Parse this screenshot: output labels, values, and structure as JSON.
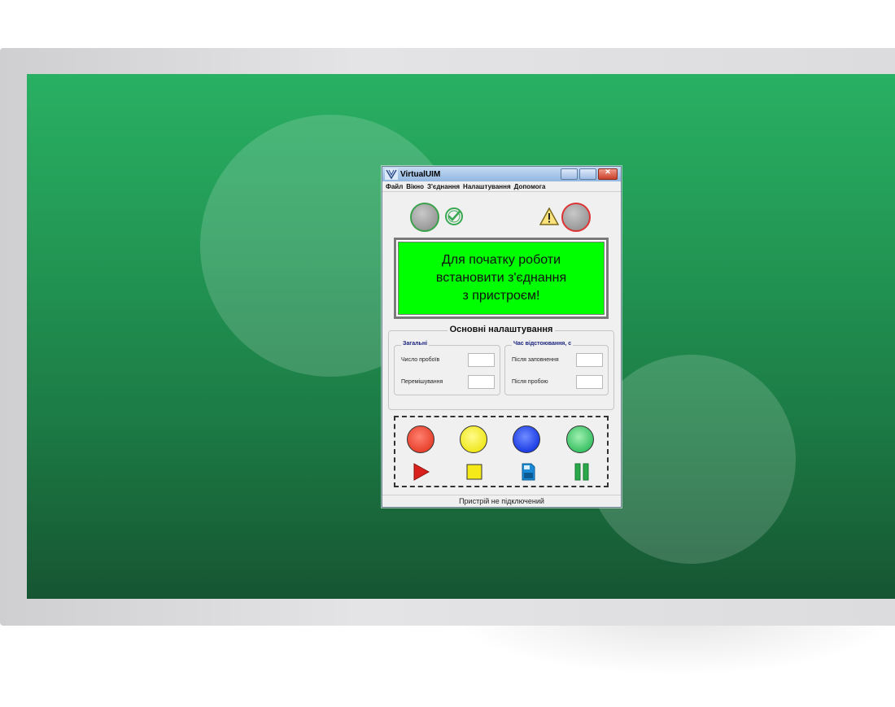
{
  "window": {
    "title": "VirtualUIM",
    "buttons": {
      "minimize": "",
      "maximize": "",
      "close": "✕"
    }
  },
  "menu": [
    "Файл",
    "Вікно",
    "З'єднання",
    "Налаштування",
    "Допомога"
  ],
  "indicators": {
    "left_icon": "check-circle-icon",
    "right_icon": "warning-icon"
  },
  "display": {
    "message": "Для початку роботи\nвстановити з'єднання\nз пристроєм!",
    "background": "#00ff00"
  },
  "settings": {
    "title": "Основні налаштування",
    "general": {
      "title": "Загальні",
      "trials_label": "Число пробоїв",
      "trials_value": "",
      "mixing_label": "Перемішування",
      "mixing_value": ""
    },
    "settling": {
      "title": "Час відстоювання, с",
      "after_fill_label": "Після заповнення",
      "after_fill_value": "",
      "after_trial_label": "Після пробою",
      "after_trial_value": ""
    }
  },
  "controls": {
    "lamps": [
      "red",
      "yellow",
      "blue",
      "green"
    ],
    "buttons": [
      "play-icon",
      "stop-icon",
      "save-icon",
      "pause-icon"
    ]
  },
  "status": "Пристрій не підключений"
}
